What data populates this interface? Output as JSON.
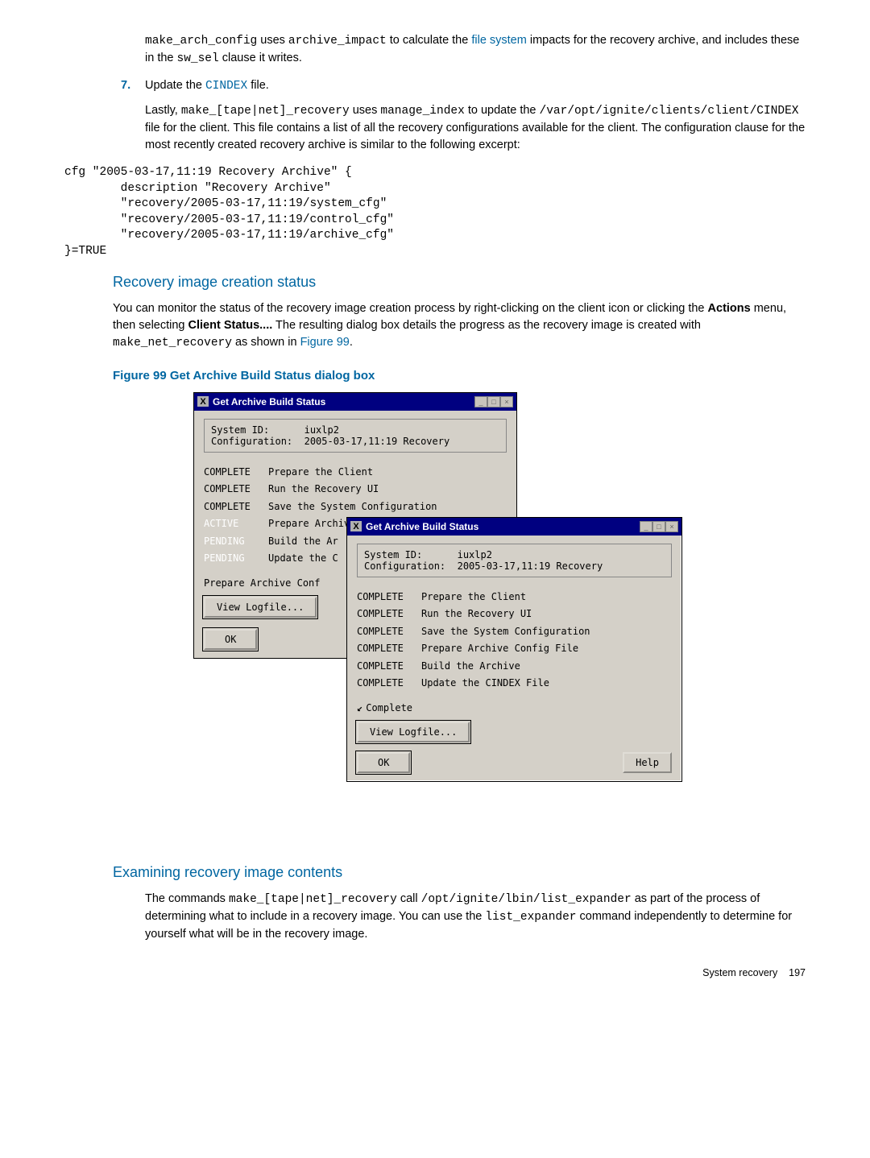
{
  "intro": {
    "p1_pre": "make_arch_config",
    "p1_mid1": " uses ",
    "p1_code2": "archive_impact",
    "p1_mid2": " to calculate the ",
    "p1_link": "file system",
    "p1_mid3": " impacts for the recovery archive, and includes these in the ",
    "p1_code3": "sw_sel",
    "p1_end": " clause it writes."
  },
  "step7": {
    "num": "7.",
    "title_a": "Update the ",
    "title_code": "CINDEX",
    "title_b": " file.",
    "p_lastly": "Lastly, ",
    "p_code1": "make_[tape|net]_recovery",
    "p_uses": " uses ",
    "p_code2": "manage_index",
    "p_to": " to update the ",
    "p_code3": "/var/opt/ignite/clients/client/CINDEX",
    "p_rest": " file for the client. This file contains a list of all the recovery configurations available for the client. The configuration clause for the most recently created recovery archive is similar to the following excerpt:",
    "code": "cfg \"2005-03-17,11:19 Recovery Archive\" {\n        description \"Recovery Archive\"\n        \"recovery/2005-03-17,11:19/system_cfg\"\n        \"recovery/2005-03-17,11:19/control_cfg\"\n        \"recovery/2005-03-17,11:19/archive_cfg\"\n}=TRUE"
  },
  "sec_status": {
    "heading": "Recovery image creation status",
    "p1_a": "You can monitor the status of the recovery image creation process by right-clicking on the client icon or clicking the ",
    "p1_b1": "Actions",
    "p1_c": " menu, then selecting ",
    "p1_b2": "Client Status....",
    "p1_d": " The resulting dialog box details the progress as the recovery image is created with ",
    "p1_code": "make_net_recovery",
    "p1_e": " as shown in ",
    "p1_link": "Figure 99",
    "p1_f": "."
  },
  "figure_title": "Figure 99 Get Archive Build Status dialog box",
  "dialog1": {
    "title": "Get Archive Build Status",
    "info": "System ID:      iuxlp2\nConfiguration:  2005-03-17,11:19 Recovery",
    "rows": [
      {
        "s": "COMPLETE",
        "t": "Prepare the Client",
        "cls": ""
      },
      {
        "s": "COMPLETE",
        "t": "Run the Recovery UI",
        "cls": ""
      },
      {
        "s": "COMPLETE",
        "t": "Save the System Configuration",
        "cls": ""
      },
      {
        "s": "ACTIVE",
        "t": "Prepare Archive Config File",
        "cls": "status-white"
      },
      {
        "s": "PENDING",
        "t": "Build the Ar",
        "cls": "status-white"
      },
      {
        "s": "PENDING",
        "t": "Update the C",
        "cls": "status-white"
      }
    ],
    "progress": "Prepare Archive Conf",
    "view": "View Logfile...",
    "ok": "OK"
  },
  "dialog2": {
    "title": "Get Archive Build Status",
    "info": "System ID:      iuxlp2\nConfiguration:  2005-03-17,11:19 Recovery",
    "rows": [
      {
        "s": "COMPLETE",
        "t": "Prepare the Client"
      },
      {
        "s": "COMPLETE",
        "t": "Run the Recovery UI"
      },
      {
        "s": "COMPLETE",
        "t": "Save the System Configuration"
      },
      {
        "s": "COMPLETE",
        "t": "Prepare Archive Config File"
      },
      {
        "s": "COMPLETE",
        "t": "Build the Archive"
      },
      {
        "s": "COMPLETE",
        "t": "Update the CINDEX File"
      }
    ],
    "progress": "Complete",
    "view": "View Logfile...",
    "ok": "OK",
    "help": "Help"
  },
  "sec_exam": {
    "heading": "Examining recovery image contents",
    "p_a": "The commands ",
    "p_code1": "make_[tape|net]_recovery",
    "p_b": " call ",
    "p_code2": "/opt/ignite/lbin/list_expander",
    "p_c": " as part of the process of determining what to include in a recovery image. You can use the ",
    "p_code3": "list_expander",
    "p_d": " command independently to determine for yourself what will be in the recovery image."
  },
  "footer": {
    "section": "System recovery",
    "page": "197"
  }
}
